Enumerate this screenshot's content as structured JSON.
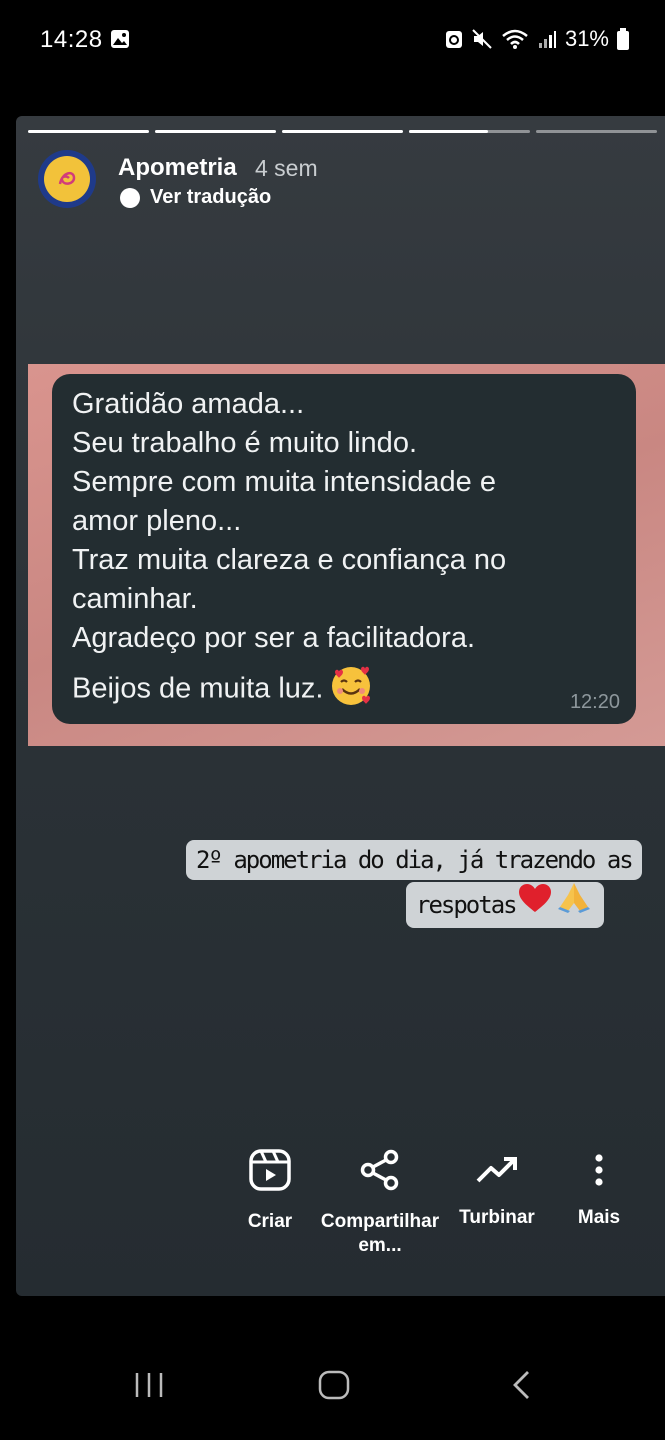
{
  "status_bar": {
    "time": "14:28",
    "battery": "31%",
    "icons": [
      "gallery-icon",
      "data-saver-icon",
      "mute-icon",
      "wifi-icon",
      "signal-icon",
      "battery-icon"
    ]
  },
  "story": {
    "progress": {
      "segments": 5,
      "current": 4,
      "current_progress": 0.65
    },
    "account": "Apometria",
    "age": "4 sem",
    "translate_label": "Ver tradução"
  },
  "chat_screenshot": {
    "lines": [
      "Gratidão amada...",
      "Seu trabalho é muito lindo.",
      "Sempre com muita intensidade e",
      "amor pleno...",
      "Traz muita clareza e confiança no",
      "caminhar.",
      "Agradeço por ser a facilitadora.",
      "Beijos de muita luz."
    ],
    "emoji": "smiling-face-with-hearts",
    "time": "12:20"
  },
  "caption": {
    "line1": "2º apometria do dia, já trazendo as",
    "line2": "respotas"
  },
  "actions": {
    "criar": "Criar",
    "compartilhar": "Compartilhar em...",
    "turbinar": "Turbinar",
    "mais": "Mais"
  },
  "colors": {
    "chat_bubble": "#232d31",
    "chat_background": "#d9948e",
    "card_background": "#2b3237",
    "caption_background": "#cfd3d6"
  }
}
